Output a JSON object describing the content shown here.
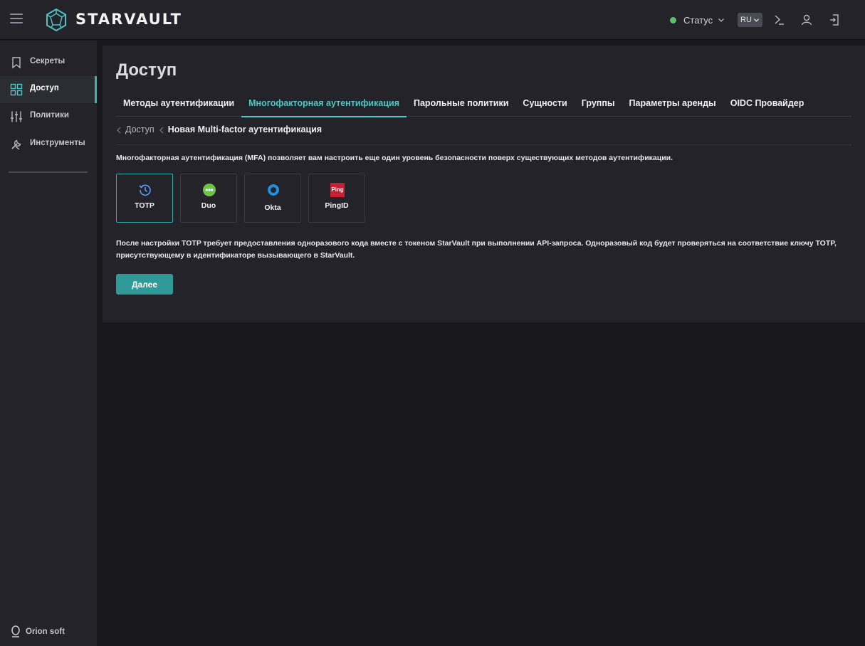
{
  "header": {
    "brand": "STARVAULT",
    "status_label": "Статус",
    "language": "RU",
    "icons": [
      "menu-icon",
      "logo-icon",
      "chevron-down-icon",
      "terminal-icon",
      "user-icon",
      "logout-icon"
    ]
  },
  "sidebar": {
    "items": [
      {
        "label": "Секреты",
        "icon": "bookmark-icon",
        "active": false
      },
      {
        "label": "Доступ",
        "icon": "grid-icon",
        "active": true
      },
      {
        "label": "Политики",
        "icon": "sliders-icon",
        "active": false
      },
      {
        "label": "Инструменты",
        "icon": "tools-icon",
        "active": false
      }
    ],
    "footer_label": "Orion soft"
  },
  "main": {
    "title": "Доступ",
    "tabs": [
      {
        "label": "Методы аутентификации",
        "active": false
      },
      {
        "label": "Многофакторная аутентификация",
        "active": true
      },
      {
        "label": "Парольные политики",
        "active": false
      },
      {
        "label": "Сущности",
        "active": false
      },
      {
        "label": "Группы",
        "active": false
      },
      {
        "label": "Параметры аренды",
        "active": false
      },
      {
        "label": "OIDC Провайдер",
        "active": false
      }
    ],
    "breadcrumb": {
      "parent": "Доступ",
      "current": "Новая Multi-factor аутентификация"
    },
    "description": "Многофакторная аутентификация (MFA) позволяет вам настроить еще один уровень безопасности поверх существующих методов аутентификации.",
    "methods": [
      {
        "label": "TOTP",
        "icon": "totp-icon",
        "selected": true
      },
      {
        "label": "Duo",
        "icon": "duo-icon",
        "selected": false
      },
      {
        "label": "Okta",
        "icon": "okta-icon",
        "selected": false
      },
      {
        "label": "PingID",
        "icon": "pingid-icon",
        "selected": false
      }
    ],
    "pingid_logo_text": "Ping",
    "info_text": "После настройки TOTP требует предоставления одноразового кода вместе с токеном StarVault при выполнении API-запроса. Одноразовый код будет проверяться на соответствие ключу TOTP, присутствующему в идентификаторе вызывающего в StarVault.",
    "next_button": "Далее"
  },
  "colors": {
    "accent": "#4fc7c4",
    "button": "#2f9a98",
    "status_ok": "#5fbf72",
    "panel": "#232329",
    "background": "#18181d"
  }
}
